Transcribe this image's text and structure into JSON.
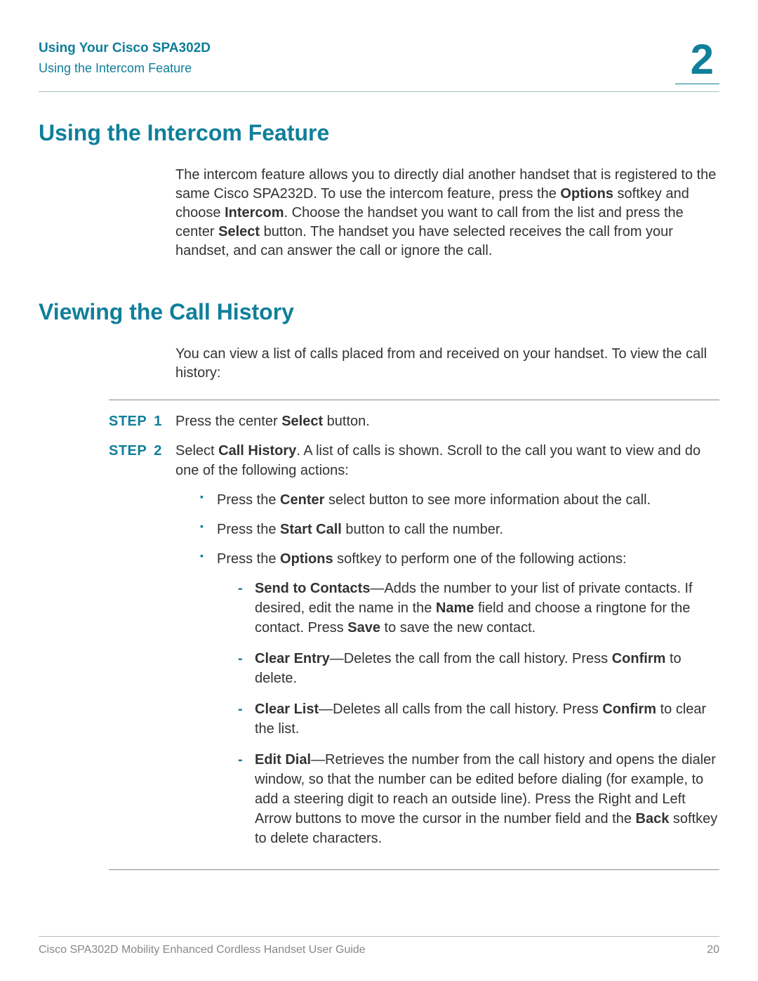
{
  "header": {
    "title": "Using Your Cisco SPA302D",
    "subtitle": "Using the Intercom Feature",
    "chapter": "2"
  },
  "section1": {
    "heading": "Using the Intercom Feature",
    "para_parts": [
      "The intercom feature allows you to directly dial another handset that is registered to the same Cisco SPA232D. To use the intercom feature, press the ",
      "Options",
      " softkey and choose ",
      "Intercom",
      ". Choose the handset you want to call from the list and press the center ",
      "Select",
      " button. The handset you have selected receives the call from your handset, and can answer the call or ignore the call."
    ]
  },
  "section2": {
    "heading": "Viewing the Call History",
    "intro": "You can view a list of calls placed from and received on your handset. To view the call history:",
    "step_label": "STEP",
    "steps": [
      {
        "num": "1",
        "parts": [
          "Press the center ",
          "Select",
          " button."
        ]
      },
      {
        "num": "2",
        "parts": [
          "Select ",
          "Call History",
          ". A list of calls is shown. Scroll to the call you want to view and do one of the following actions:"
        ],
        "bullets": [
          {
            "parts": [
              "Press the ",
              "Center",
              " select button to see more information about the call."
            ]
          },
          {
            "parts": [
              "Press the ",
              "Start Call",
              " button to call the number."
            ]
          },
          {
            "parts": [
              "Press the ",
              "Options",
              " softkey to perform one of the following actions:"
            ],
            "sub": [
              {
                "parts": [
                  "Send to Contacts",
                  "—Adds the number to your list of private contacts. If desired, edit the name in the ",
                  "Name",
                  " field and choose a ringtone for the contact. Press ",
                  "Save",
                  " to save the new contact."
                ]
              },
              {
                "parts": [
                  "Clear Entry",
                  "—Deletes the call from the call history. Press ",
                  "Confirm",
                  " to delete."
                ]
              },
              {
                "parts": [
                  "Clear List",
                  "—Deletes all calls from the call history. Press ",
                  "Confirm",
                  " to clear the list."
                ]
              },
              {
                "parts": [
                  "Edit Dial",
                  "—Retrieves the number from the call history and opens the dialer window, so that the number can be edited before dialing (for example, to add a steering digit to reach an outside line). Press the Right and Left Arrow buttons to move the cursor in the number field and the ",
                  "Back",
                  " softkey to delete characters."
                ]
              }
            ]
          }
        ]
      }
    ]
  },
  "footer": {
    "left": "Cisco SPA302D Mobility Enhanced Cordless Handset User Guide",
    "right": "20"
  }
}
